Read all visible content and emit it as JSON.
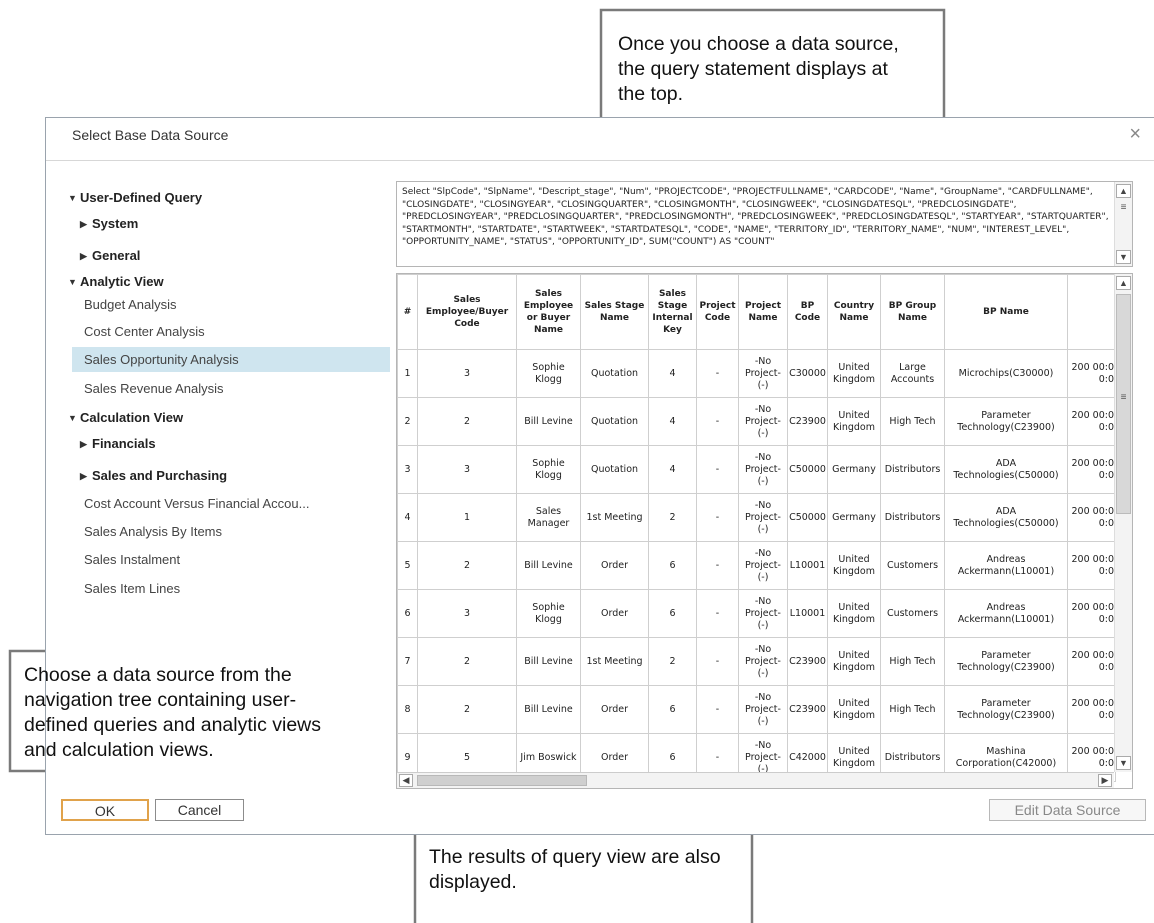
{
  "dialog": {
    "title": "Select Base Data Source",
    "close_glyph": "×"
  },
  "tree": {
    "user_defined_query": "User-Defined Query",
    "system": "System",
    "general": "General",
    "analytic_view": "Analytic View",
    "budget_analysis": "Budget Analysis",
    "cost_center_analysis": "Cost Center Analysis",
    "sales_opportunity_analysis": "Sales Opportunity Analysis",
    "sales_revenue_analysis": "Sales Revenue Analysis",
    "calculation_view": "Calculation View",
    "financials": "Financials",
    "sales_and_purchasing": "Sales and Purchasing",
    "cost_account": "Cost Account Versus Financial Accou...",
    "sales_analysis_by_items": "Sales Analysis By Items",
    "sales_instalment": "Sales Instalment",
    "sales_item_lines": "Sales Item Lines"
  },
  "query": {
    "statement": "Select \"SlpCode\", \"SlpName\", \"Descript_stage\", \"Num\", \"PROJECTCODE\", \"PROJECTFULLNAME\", \"CARDCODE\", \"Name\", \"GroupName\", \"CARDFULLNAME\", \"CLOSINGDATE\", \"CLOSINGYEAR\", \"CLOSINGQUARTER\", \"CLOSINGMONTH\", \"CLOSINGWEEK\", \"CLOSINGDATESQL\", \"PREDCLOSINGDATE\", \"PREDCLOSINGYEAR\", \"PREDCLOSINGQUARTER\", \"PREDCLOSINGMONTH\", \"PREDCLOSINGWEEK\", \"PREDCLOSINGDATESQL\", \"STARTYEAR\", \"STARTQUARTER\", \"STARTMONTH\", \"STARTDATE\", \"STARTWEEK\", \"STARTDATESQL\", \"CODE\", \"NAME\", \"TERRITORY_ID\", \"TERRITORY_NAME\", \"NUM\", \"INTEREST_LEVEL\", \"OPPORTUNITY_NAME\", \"STATUS\", \"OPPORTUNITY_ID\", SUM(\"COUNT\") AS \"COUNT\""
  },
  "grid": {
    "headers": [
      "#",
      "Sales Employee/Buyer Code",
      "Sales Employee or Buyer Name",
      "Sales Stage Name",
      "Sales Stage Internal Key",
      "Project Code",
      "Project Name",
      "BP Code",
      "Country Name",
      "BP Group Name",
      "BP Name",
      ""
    ],
    "rows": [
      [
        "1",
        "3",
        "Sophie Klogg",
        "Quotation",
        "4",
        "-",
        "-No Project-(-)",
        "C30000",
        "United Kingdom",
        "Large Accounts",
        "Microchips(C30000)",
        "200 00:00:0"
      ],
      [
        "2",
        "2",
        "Bill Levine",
        "Quotation",
        "4",
        "-",
        "-No Project-(-)",
        "C23900",
        "United Kingdom",
        "High Tech",
        "Parameter Technology(C23900)",
        "200 00:00:0"
      ],
      [
        "3",
        "3",
        "Sophie Klogg",
        "Quotation",
        "4",
        "-",
        "-No Project-(-)",
        "C50000",
        "Germany",
        "Distributors",
        "ADA Technologies(C50000)",
        "200 00:00:0"
      ],
      [
        "4",
        "1",
        "Sales Manager",
        "1st Meeting",
        "2",
        "-",
        "-No Project-(-)",
        "C50000",
        "Germany",
        "Distributors",
        "ADA Technologies(C50000)",
        "200 00:00:0"
      ],
      [
        "5",
        "2",
        "Bill Levine",
        "Order",
        "6",
        "-",
        "-No Project-(-)",
        "L10001",
        "United Kingdom",
        "Customers",
        "Andreas Ackermann(L10001)",
        "200 00:00:0"
      ],
      [
        "6",
        "3",
        "Sophie Klogg",
        "Order",
        "6",
        "-",
        "-No Project-(-)",
        "L10001",
        "United Kingdom",
        "Customers",
        "Andreas Ackermann(L10001)",
        "200 00:00:0"
      ],
      [
        "7",
        "2",
        "Bill Levine",
        "1st Meeting",
        "2",
        "-",
        "-No Project-(-)",
        "C23900",
        "United Kingdom",
        "High Tech",
        "Parameter Technology(C23900)",
        "200 00:00:0"
      ],
      [
        "8",
        "2",
        "Bill Levine",
        "Order",
        "6",
        "-",
        "-No Project-(-)",
        "C23900",
        "United Kingdom",
        "High Tech",
        "Parameter Technology(C23900)",
        "200 00:00:0"
      ],
      [
        "9",
        "5",
        "Jim Boswick",
        "Order",
        "6",
        "-",
        "-No Project-(-)",
        "C42000",
        "United Kingdom",
        "Distributors",
        "Mashina Corporation(C42000)",
        "200 00:00:0"
      ]
    ]
  },
  "buttons": {
    "ok": "OK",
    "cancel": "Cancel",
    "edit_data_source": "Edit Data Source"
  },
  "callouts": {
    "top": "Once you choose a data source, the query statement displays at the top.",
    "left": "Choose a data source from the navigation tree containing user-defined queries and analytic views and calculation  views.",
    "bottom": "The results of query view are also displayed."
  },
  "icons": {
    "expanded": "caret-down-icon",
    "collapsed": "caret-right-icon"
  }
}
